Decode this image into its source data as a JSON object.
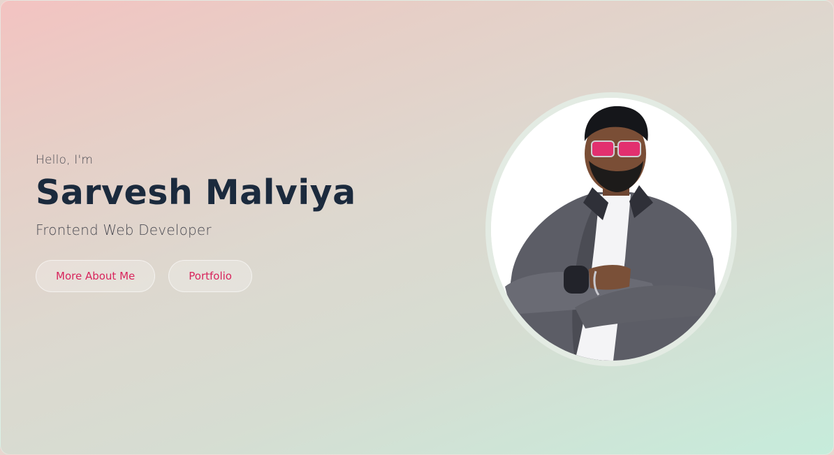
{
  "hero": {
    "greeting": "Hello, I'm",
    "name": "Sarvesh Malviya",
    "role": "Frontend Web Developer",
    "buttons": {
      "about": "More About Me",
      "portfolio": "Portfolio"
    },
    "photo_alt": "Sarvesh Malviya portrait"
  },
  "colors": {
    "accent": "#d8245c",
    "name_text": "#1b2a3d",
    "gradient_start": "#f3c3c1",
    "gradient_end": "#c6ecdb"
  }
}
